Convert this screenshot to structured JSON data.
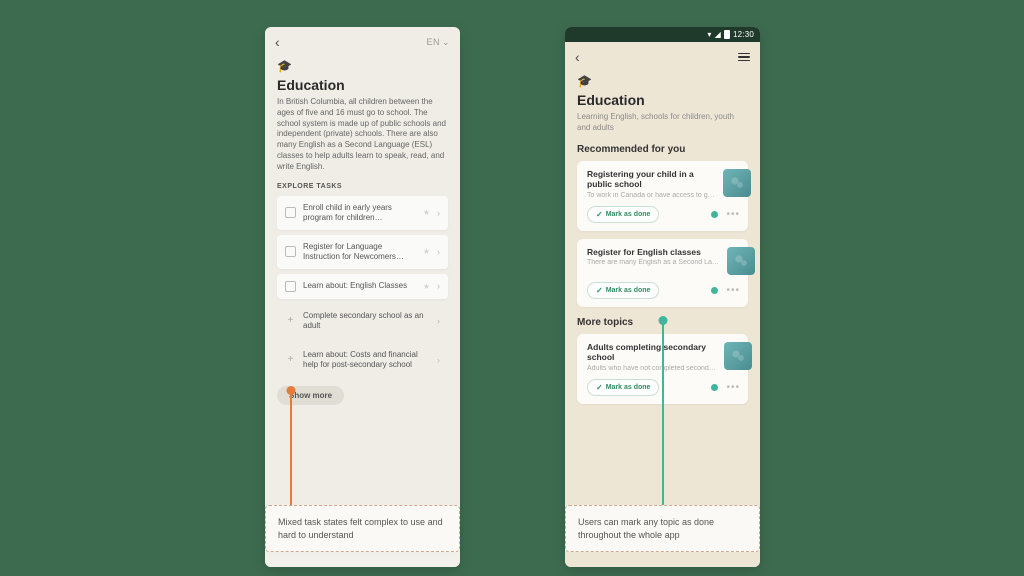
{
  "left": {
    "topbar": {
      "lang": "EN"
    },
    "title": "Education",
    "desc": "In British Columbia, all children between the ages of five and 16 must go to school. The school system is made up of public schools and independent (private) schools. There are also many English as a Second Language (ESL) classes to help adults learn to speak, read, and write English.",
    "section_label": "EXPLORE TASKS",
    "tasks": [
      {
        "kind": "check",
        "text": "Enroll child in early years program for children…"
      },
      {
        "kind": "check",
        "text": "Register for Language Instruction for Newcomers…"
      },
      {
        "kind": "check",
        "text": "Learn about: English Classes"
      },
      {
        "kind": "plus",
        "text": "Complete secondary school as an adult"
      },
      {
        "kind": "plus",
        "text": "Learn about: Costs and financial help for post-secondary school"
      }
    ],
    "show_more": "Show more"
  },
  "right": {
    "status_time": "12:30",
    "title": "Education",
    "desc": "Learning English, schools for children, youth and adults",
    "rec_label": "Recommended for you",
    "more_label": "More topics",
    "mark_done": "Mark as done",
    "recs": [
      {
        "title": "Registering your child in a public school",
        "sub": "To work in Canada or have access to g…"
      },
      {
        "title": "Register for English classes",
        "sub": "There are many English as a Second La…"
      }
    ],
    "more": [
      {
        "title": "Adults completing secondary school",
        "sub": "Adults who have not completed second…"
      }
    ]
  },
  "captions": {
    "left": "Mixed task states felt complex to use and hard to understand",
    "right": "Users can mark any topic as done throughout the whole app"
  }
}
